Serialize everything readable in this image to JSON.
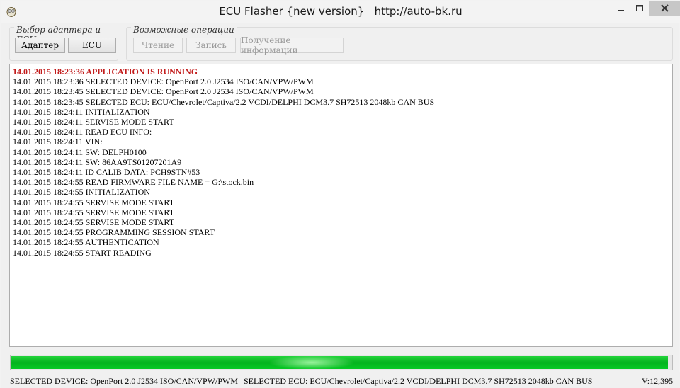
{
  "window": {
    "title": "ECU Flasher {new version}   http://auto-bk.ru",
    "app_icon": "owl-icon",
    "controls": [
      "minimize-icon",
      "maximize-icon",
      "close-icon"
    ]
  },
  "toolbar": {
    "adapter_group_label": "Выбор адаптера и ECU",
    "adapter_button": "Адаптер",
    "ecu_button": "ECU",
    "operations_group_label": "Возможные операции",
    "read_button": "Чтение",
    "write_button": "Запись",
    "info_button": "Получение информации"
  },
  "log": {
    "lines": [
      "14.01.2015 18:23:36 APPLICATION IS RUNNING",
      "14.01.2015 18:23:36 SELECTED DEVICE: OpenPort 2.0 J2534 ISO/CAN/VPW/PWM",
      "14.01.2015 18:23:45 SELECTED DEVICE: OpenPort 2.0 J2534 ISO/CAN/VPW/PWM",
      "14.01.2015 18:23:45 SELECTED ECU: ECU/Chevrolet/Captiva/2.2 VCDI/DELPHI DCM3.7 SH72513 2048kb CAN BUS",
      "14.01.2015 18:24:11 INITIALIZATION",
      "14.01.2015 18:24:11 SERVISE MODE START",
      "14.01.2015 18:24:11 READ ECU INFO:",
      "14.01.2015 18:24:11 VIN:",
      "14.01.2015 18:24:11 SW: DELPH0100",
      "14.01.2015 18:24:11 SW: 86AA9TS01207201A9",
      "14.01.2015 18:24:11 ID CALIB DATA: PCH9STN#53",
      "14.01.2015 18:24:55 READ FIRMWARE FILE NAME = G:\\stock.bin",
      "14.01.2015 18:24:55 INITIALIZATION",
      "14.01.2015 18:24:55 SERVISE MODE START",
      "14.01.2015 18:24:55 SERVISE MODE START",
      "14.01.2015 18:24:55 SERVISE MODE START",
      "14.01.2015 18:24:55 PROGRAMMING SESSION START",
      "14.01.2015 18:24:55 AUTHENTICATION",
      "14.01.2015 18:24:55 START READING"
    ],
    "highlight_color": "#c21c1c"
  },
  "progress": {
    "value": 0.995,
    "color": "#06b522"
  },
  "status": {
    "device": "SELECTED DEVICE: OpenPort 2.0 J2534 ISO/CAN/VPW/PWM",
    "ecu": "SELECTED ECU: ECU/Chevrolet/Captiva/2.2 VCDI/DELPHI DCM3.7 SH72513 2048kb CAN BUS",
    "version": "V:12,395"
  }
}
